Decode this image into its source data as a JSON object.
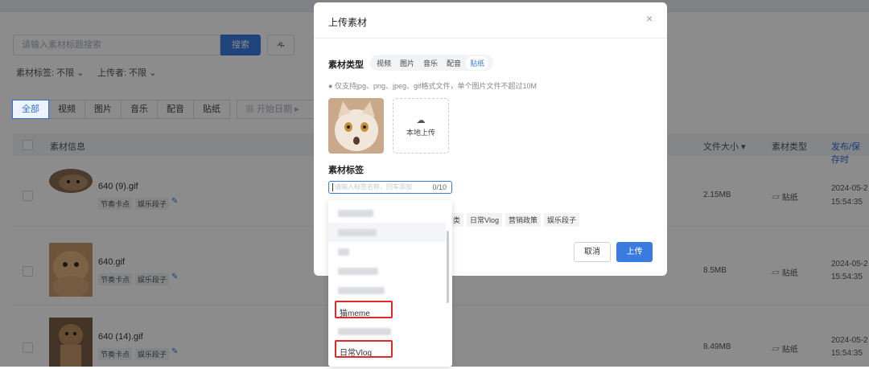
{
  "page": {
    "search": {
      "placeholder": "请输入素材标题搜索",
      "button": "搜索",
      "user_button": "ዱ"
    },
    "filters": {
      "tag": "素材标签: 不限 ⌄",
      "uploader": "上传者: 不限 ⌄"
    },
    "tabs": [
      "全部",
      "视频",
      "图片",
      "音乐",
      "配音",
      "贴纸"
    ],
    "date_range": {
      "start_placeholder": "开始日期"
    },
    "table": {
      "headers": {
        "info": "素材信息",
        "size": "文件大小 ▾",
        "type": "素材类型",
        "time": "发布/保存时"
      },
      "rows": [
        {
          "name": "640 (9).gif",
          "tags": [
            "节奏卡点",
            "娱乐段子"
          ],
          "size": "2.15MB",
          "type": "贴纸",
          "date": "2024-05-2",
          "time": "15:54:35"
        },
        {
          "name": "640.gif",
          "tags": [
            "节奏卡点",
            "娱乐段子"
          ],
          "size": "8.5MB",
          "type": "贴纸",
          "date": "2024-05-2",
          "time": "15:54:35"
        },
        {
          "name": "640 (14).gif",
          "tags": [
            "节奏卡点",
            "娱乐段子"
          ],
          "size": "8.49MB",
          "type": "贴纸",
          "date": "2024-05-2",
          "time": "15:54:35"
        }
      ]
    }
  },
  "modal": {
    "title": "上传素材",
    "close": "×",
    "type_label": "素材类型",
    "types": [
      "视频",
      "图片",
      "音乐",
      "配音",
      "贴纸"
    ],
    "active_type": "贴纸",
    "hint": "仅支持jpg、png、jpeg、gif格式文件，单个图片文件不超过10M",
    "upload_text": "本地上传",
    "tags_label": "素材标签",
    "tag_input": {
      "placeholder": "请输入标签名称，回车添加",
      "counter": "0/10"
    },
    "visible_chips": [
      "类",
      "日常Vlog",
      "营销政策",
      "娱乐段子"
    ],
    "cancel": "取消",
    "submit": "上传",
    "dropdown_items": [
      "",
      "",
      "",
      "",
      "",
      "猫meme",
      "",
      "日常Vlog"
    ]
  },
  "colors": {
    "primary": "#3a7be0",
    "highlight": "#e02a2a"
  }
}
